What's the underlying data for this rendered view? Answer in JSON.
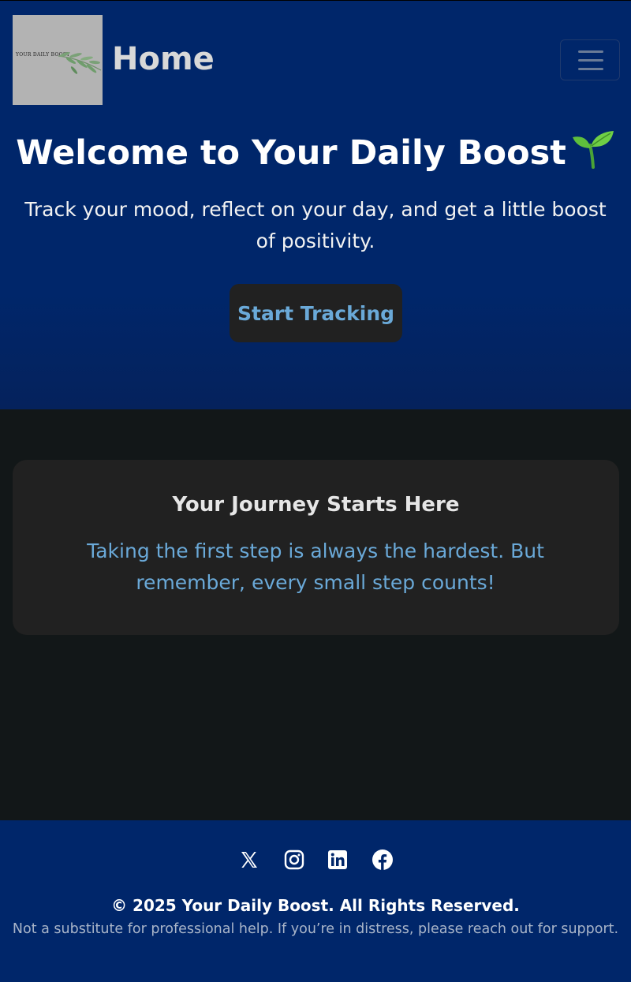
{
  "navbar": {
    "logo_text": "YOUR DAILY BOOST",
    "brand": "Home",
    "toggler_icon": "hamburger-menu-icon"
  },
  "hero": {
    "title": "Welcome to Your Daily Boost",
    "title_icon": "seedling-emoji",
    "subtitle": "Track your mood, reflect on your day, and get a little boost of positivity.",
    "cta_label": "Start Tracking"
  },
  "card": {
    "title": "Your Journey Starts Here",
    "text": "Taking the first step is always the hardest. But remember, every small step counts!"
  },
  "footer": {
    "socials": [
      "x-icon",
      "instagram-icon",
      "linkedin-icon",
      "facebook-icon"
    ],
    "copyright": "© 2025 Your Daily Boost. All Rights Reserved.",
    "disclaimer": "Not a substitute for professional help. If you’re in distress, please reach out for support."
  },
  "colors": {
    "navy": "#00266a",
    "dark_bg": "#121718",
    "card_bg": "#212121",
    "accent_blue": "#6aa9d8",
    "leaf_green": "#6f9d6c"
  }
}
